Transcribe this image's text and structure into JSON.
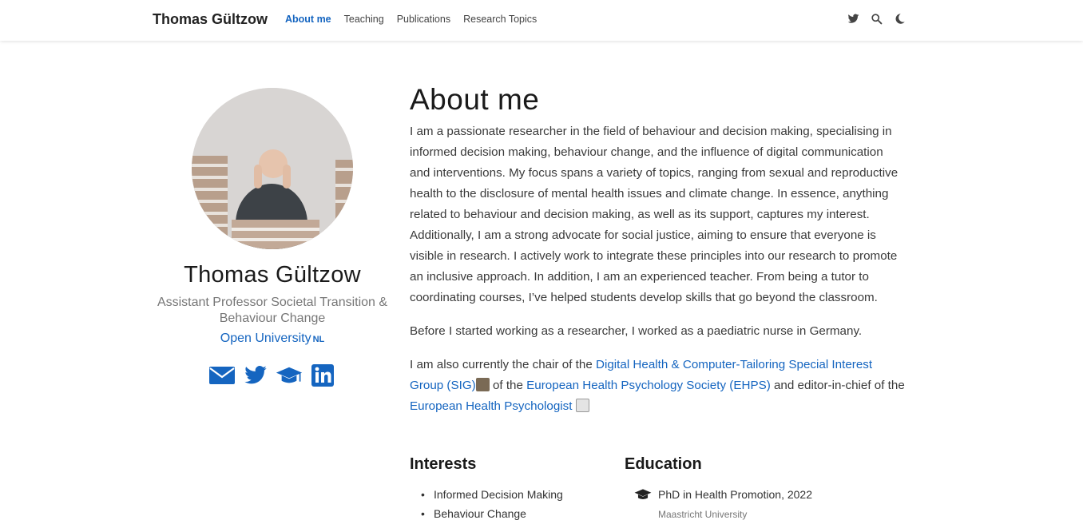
{
  "nav": {
    "brand": "Thomas Gültzow",
    "links": [
      "About me",
      "Teaching",
      "Publications",
      "Research Topics"
    ],
    "icons": [
      "twitter-icon",
      "search-icon",
      "moon-icon"
    ]
  },
  "profile": {
    "name": "Thomas Gültzow",
    "role": "Assistant Professor Societal Transition & Behaviour Change",
    "org": "Open University",
    "org_suffix": "NL",
    "social_icons": [
      "envelope-icon",
      "twitter-icon",
      "graduation-cap-icon",
      "linkedin-icon"
    ]
  },
  "main": {
    "title": "About me",
    "p1": "I am a passionate researcher in the field of behaviour and decision making, specialising in informed decision making, behaviour change, and the influence of digital communication and interventions. My focus spans a variety of topics, ranging from sexual and reproductive health to the disclosure of mental health issues and climate change. In essence, anything related to behaviour and decision making, as well as its support, captures my interest. Additionally, I am a strong advocate for social justice, aiming to ensure that everyone is visible in research. I actively work to integrate these principles into our research to promote an inclusive approach. In addition, I am an experienced teacher. From being a tutor to coordinating courses, I’ve helped students develop skills that go beyond the classroom.",
    "p2": "Before I started working as a researcher, I worked as a paediatric nurse in Germany.",
    "p3_a": "I am also currently the chair of the ",
    "p3_link1": "Digital Health & Computer-Tailoring Special Interest Group (SIG)",
    "p3_b": " of the ",
    "p3_link2": "European Health Psychology Society (EHPS)",
    "p3_c": " and editor-in-chief of the ",
    "p3_link3": "European Health Psychologist"
  },
  "interests": {
    "title": "Interests",
    "items": [
      "Informed Decision Making",
      "Behaviour Change"
    ]
  },
  "education": {
    "title": "Education",
    "items": [
      {
        "degree": "PhD in Health Promotion, 2022",
        "institution": "Maastricht University"
      }
    ]
  },
  "colors": {
    "accent": "#1565c0",
    "text": "#3a3a3a"
  }
}
